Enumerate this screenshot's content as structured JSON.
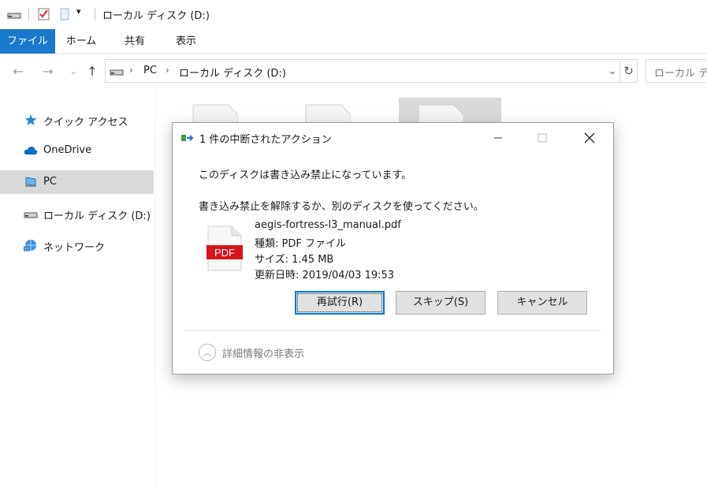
{
  "window": {
    "title": "ローカル ディスク (D:)"
  },
  "ribbon": {
    "tabs": [
      "ファイル",
      "ホーム",
      "共有",
      "表示"
    ]
  },
  "address": {
    "crumbs": [
      "PC",
      "ローカル ディスク (D:)"
    ],
    "search_placeholder": "ローカル ディ"
  },
  "nav_pane": {
    "items": [
      {
        "label": "クイック アクセス",
        "icon": "star-icon"
      },
      {
        "label": "OneDrive",
        "icon": "cloud-icon"
      },
      {
        "label": "PC",
        "icon": "computer-icon"
      },
      {
        "label": "ローカル ディスク (D:)",
        "icon": "drive-icon"
      },
      {
        "label": "ネットワーク",
        "icon": "network-icon"
      }
    ]
  },
  "dialog": {
    "title": "1 件の中断されたアクション",
    "message1": "このディスクは書き込み禁止になっています。",
    "message2": "書き込み禁止を解除するか、別のディスクを使ってください。",
    "file": {
      "name": "aegis-fortress-l3_manual.pdf",
      "type": "種類: PDF ファイル",
      "size": "サイズ: 1.45 MB",
      "modified": "更新日時: 2019/04/03 19:53",
      "icon_label": "PDF"
    },
    "buttons": {
      "retry": "再試行(R)",
      "skip": "スキップ(S)",
      "cancel": "キャンセル"
    },
    "details_toggle": "詳細情報の非表示"
  },
  "colors": {
    "accent": "#1979ca",
    "pdf_red": "#d7141a",
    "focus": "#0078d7"
  }
}
